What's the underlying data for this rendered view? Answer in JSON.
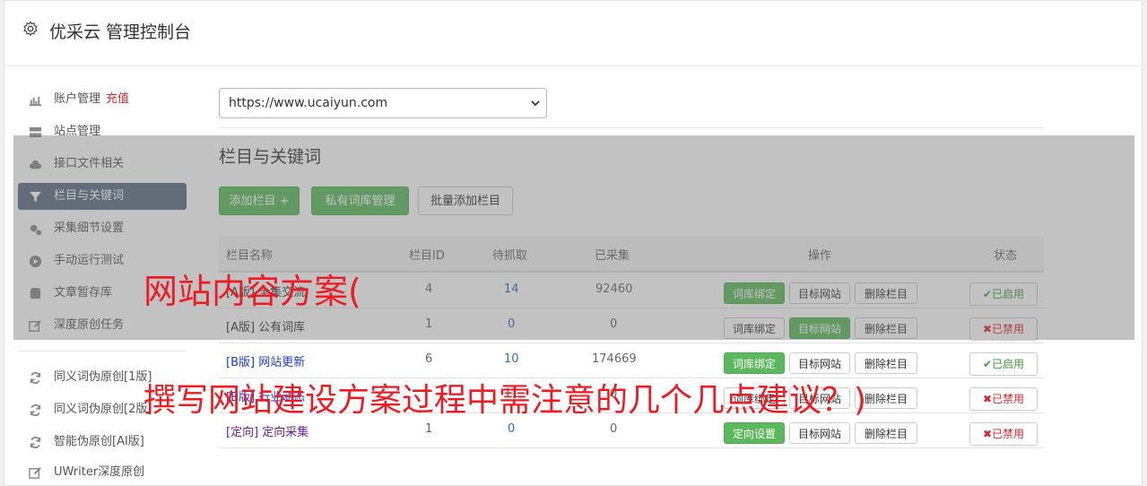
{
  "app": {
    "title": "优采云 管理控制台",
    "icon": "gear-icon"
  },
  "sidebar": {
    "items": [
      {
        "label": "账户管理",
        "badge": "充值",
        "icon": "bar-chart-icon"
      },
      {
        "label": "站点管理",
        "icon": "server-icon"
      },
      {
        "label": "接口文件相关",
        "icon": "cloud-upload-icon"
      },
      {
        "label": "栏目与关键词",
        "icon": "filter-icon",
        "active": true
      },
      {
        "label": "采集细节设置",
        "icon": "cogs-icon"
      },
      {
        "label": "手动运行测试",
        "icon": "play-circle-icon"
      },
      {
        "label": "文章暂存库",
        "icon": "database-icon"
      },
      {
        "label": "深度原创任务",
        "icon": "edit-icon"
      },
      {
        "label": "同义词伪原创[1版]",
        "icon": "refresh-icon"
      },
      {
        "label": "同义词伪原创[2版]",
        "icon": "refresh-icon"
      },
      {
        "label": "智能伪原创[AI版]",
        "icon": "refresh-icon"
      },
      {
        "label": "UWriter深度原创",
        "icon": "edit-icon"
      }
    ]
  },
  "site_select": {
    "value": "https://www.ucaiyun.com"
  },
  "section": {
    "title": "栏目与关键词"
  },
  "toolbar": {
    "add_label": "添加栏目 +",
    "private_lib_label": "私有词库管理",
    "batch_add_label": "批量添加栏目"
  },
  "table": {
    "columns": [
      "栏目名称",
      "栏目ID",
      "待抓取",
      "已采集",
      "操作",
      "状态"
    ],
    "rows": [
      {
        "name": "[A版] 全集交流",
        "name_style": "a",
        "id": "4",
        "pending": "14",
        "collected": "92460",
        "actions": [
          {
            "label": "词库绑定",
            "style": "green"
          },
          {
            "label": "目标网站",
            "style": "white"
          },
          {
            "label": "删除栏目",
            "style": "white"
          }
        ],
        "status": "已启用",
        "status_on": true
      },
      {
        "name": "[A版] 公有词库",
        "name_style": "a",
        "id": "1",
        "pending": "0",
        "collected": "0",
        "actions": [
          {
            "label": "词库绑定",
            "style": "white"
          },
          {
            "label": "目标网站",
            "style": "green"
          },
          {
            "label": "删除栏目",
            "style": "white"
          }
        ],
        "status": "已禁用",
        "status_on": false
      },
      {
        "name": "[B版] 网站更新",
        "name_style": "b",
        "id": "6",
        "pending": "10",
        "collected": "174669",
        "actions": [
          {
            "label": "词库绑定",
            "style": "green"
          },
          {
            "label": "目标网站",
            "style": "white"
          },
          {
            "label": "删除栏目",
            "style": "white"
          }
        ],
        "status": "已启用",
        "status_on": true
      },
      {
        "name": "[B版] 行业动态",
        "name_style": "b",
        "id": "",
        "pending": "11",
        "collected": "0",
        "actions": [
          {
            "label": "词库绑定",
            "style": "white"
          },
          {
            "label": "目标网站",
            "style": "white"
          },
          {
            "label": "删除栏目",
            "style": "white"
          }
        ],
        "status": "已禁用",
        "status_on": false
      },
      {
        "name": "[定向] 定向采集",
        "name_style": "d",
        "id": "1",
        "pending": "0",
        "collected": "0",
        "actions": [
          {
            "label": "定向设置",
            "style": "green"
          },
          {
            "label": "目标网站",
            "style": "white"
          },
          {
            "label": "删除栏目",
            "style": "white"
          }
        ],
        "status": "已禁用",
        "status_on": false
      }
    ]
  },
  "overlay_text": {
    "line1": "网站内容方案(",
    "line2": "撰写网站建设方案过程中需注意的几个几点建议？)"
  },
  "colors": {
    "accent": "#5a6d82",
    "green": "#5cb85c",
    "banner_red": "#ee1b22"
  }
}
